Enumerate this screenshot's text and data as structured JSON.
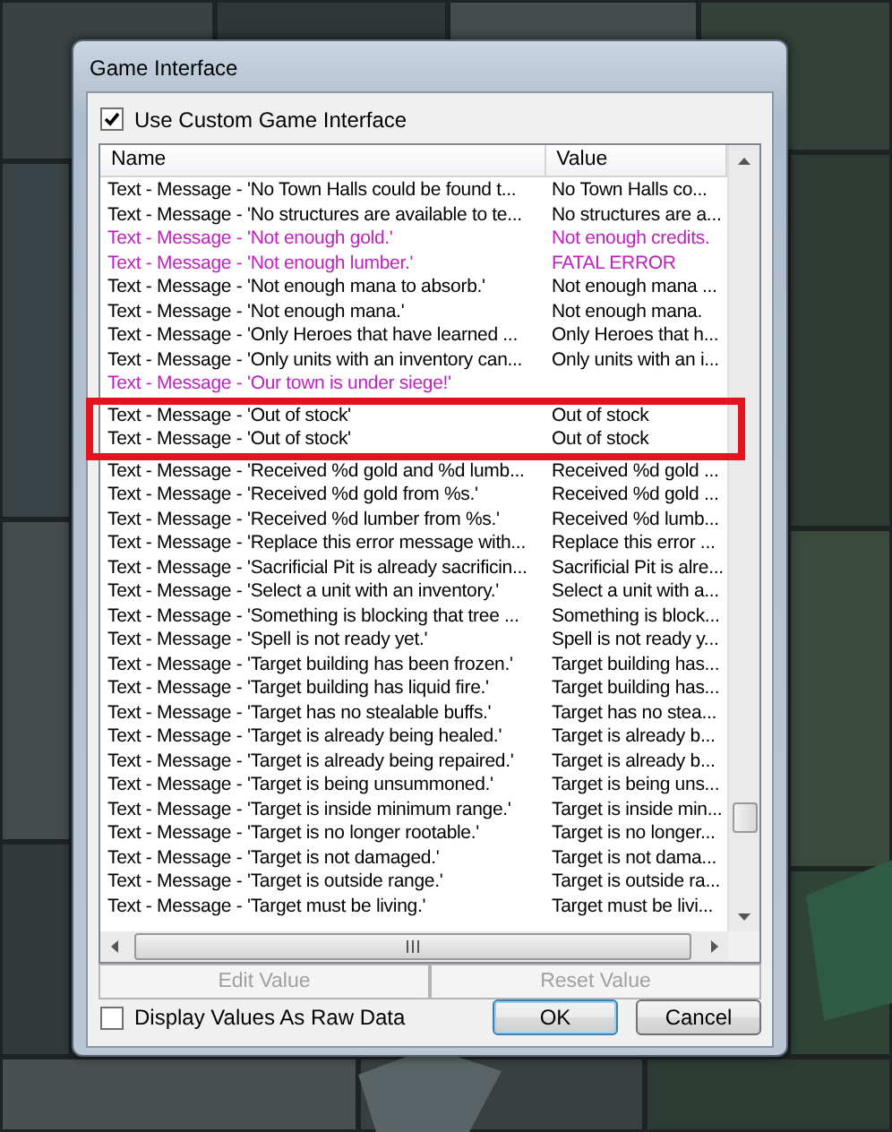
{
  "window": {
    "title": "Game Interface"
  },
  "use_custom": {
    "label": "Use Custom Game Interface",
    "checked": true
  },
  "table": {
    "columns": [
      "Name",
      "Value"
    ],
    "rows": [
      {
        "kind": "row",
        "name": "Text - Message - 'No Town Halls could be found t...",
        "value": "No Town Halls co...",
        "modified": false
      },
      {
        "kind": "row",
        "name": "Text - Message - 'No structures are available to te...",
        "value": "No structures are a...",
        "modified": false
      },
      {
        "kind": "row",
        "name": "Text - Message - 'Not enough gold.'",
        "value": "Not enough credits.",
        "modified": true
      },
      {
        "kind": "row",
        "name": "Text - Message - 'Not enough lumber.'",
        "value": "FATAL ERROR",
        "modified": true
      },
      {
        "kind": "row",
        "name": "Text - Message - 'Not enough mana to absorb.'",
        "value": "Not enough mana ...",
        "modified": false
      },
      {
        "kind": "row",
        "name": "Text - Message - 'Not enough mana.'",
        "value": "Not enough mana.",
        "modified": false
      },
      {
        "kind": "row",
        "name": "Text - Message - 'Only Heroes that have learned ...",
        "value": "Only Heroes that h...",
        "modified": false
      },
      {
        "kind": "row",
        "name": "Text - Message - 'Only units with an inventory can...",
        "value": "Only units with an i...",
        "modified": false
      },
      {
        "kind": "row",
        "name": "Text - Message - 'Our town is under siege!'",
        "modified": true
      },
      {
        "kind": "highlight_box",
        "rows": [
          {
            "name": "Text - Message - 'Out of stock'",
            "value": "Out of stock",
            "modified": false
          },
          {
            "name": "Text - Message - 'Out of stock'",
            "value": "Out of stock",
            "modified": false
          }
        ]
      },
      {
        "kind": "row",
        "name": "Text - Message - 'Received %d gold and %d lumb...",
        "value": "Received %d gold ...",
        "modified": false
      },
      {
        "kind": "row",
        "name": "Text - Message - 'Received %d gold from %s.'",
        "value": "Received %d gold ...",
        "modified": false
      },
      {
        "kind": "row",
        "name": "Text - Message - 'Received %d lumber from %s.'",
        "value": "Received %d lumb...",
        "modified": false
      },
      {
        "kind": "row",
        "name": "Text - Message - 'Replace this error message with...",
        "value": "Replace this error ...",
        "modified": false
      },
      {
        "kind": "row",
        "name": "Text - Message - 'Sacrificial Pit is already sacrificin...",
        "value": "Sacrificial Pit is alre...",
        "modified": false
      },
      {
        "kind": "row",
        "name": "Text - Message - 'Select a unit with an inventory.'",
        "value": "Select a unit with a...",
        "modified": false
      },
      {
        "kind": "row",
        "name": "Text - Message - 'Something is blocking that tree ...",
        "value": "Something is block...",
        "modified": false
      },
      {
        "kind": "row",
        "name": "Text - Message - 'Spell is not ready yet.'",
        "value": "Spell is not ready y...",
        "modified": false
      },
      {
        "kind": "row",
        "name": "Text - Message - 'Target building has been frozen.'",
        "value": "Target building has...",
        "modified": false
      },
      {
        "kind": "row",
        "name": "Text - Message - 'Target building has liquid fire.'",
        "value": "Target building has...",
        "modified": false
      },
      {
        "kind": "row",
        "name": "Text - Message - 'Target has no stealable buffs.'",
        "value": "Target has no stea...",
        "modified": false
      },
      {
        "kind": "row",
        "name": "Text - Message - 'Target is already being healed.'",
        "value": "Target is already b...",
        "modified": false
      },
      {
        "kind": "row",
        "name": "Text - Message - 'Target is already being repaired.'",
        "value": "Target is already b...",
        "modified": false
      },
      {
        "kind": "row",
        "name": "Text - Message - 'Target is being unsummoned.'",
        "value": "Target is being uns...",
        "modified": false
      },
      {
        "kind": "row",
        "name": "Text - Message - 'Target is inside minimum range.'",
        "value": "Target is inside min...",
        "modified": false
      },
      {
        "kind": "row",
        "name": "Text - Message - 'Target is no longer rootable.'",
        "value": "Target is no longer...",
        "modified": false
      },
      {
        "kind": "row",
        "name": "Text - Message - 'Target is not damaged.'",
        "value": "Target is not dama...",
        "modified": false
      },
      {
        "kind": "row",
        "name": "Text - Message - 'Target is outside range.'",
        "value": "Target is outside ra...",
        "modified": false
      },
      {
        "kind": "row",
        "name": "Text - Message - 'Target must be living.'",
        "value": "Target must be livi...",
        "modified": false
      }
    ]
  },
  "list_buttons": [
    {
      "label": "Edit Value",
      "disabled": true
    },
    {
      "label": "Reset Value",
      "disabled": true
    }
  ],
  "raw_data": {
    "label": "Display Values As Raw Data",
    "checked": false
  },
  "buttons": [
    {
      "label": "OK",
      "default": true
    },
    {
      "label": "Cancel",
      "default": false
    }
  ]
}
